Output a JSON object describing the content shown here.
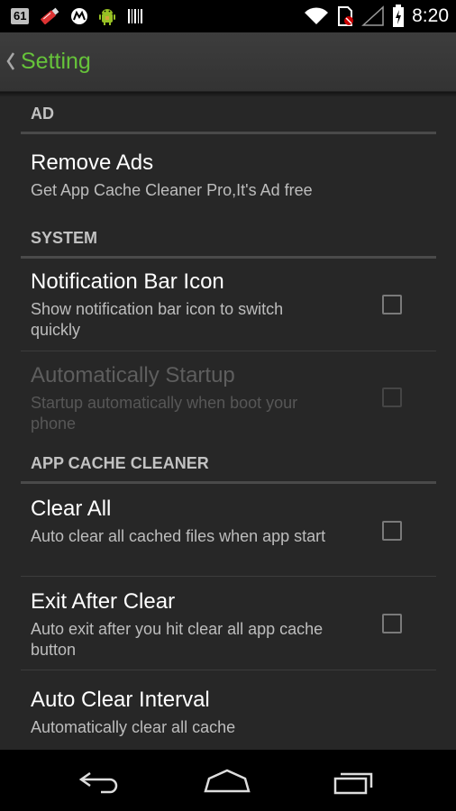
{
  "status_bar": {
    "badge": "61",
    "time": "8:20",
    "icons": [
      "usb-icon",
      "motorola-icon",
      "android-debug-icon",
      "barcode-icon",
      "wifi-icon",
      "no-sim-icon",
      "signal-icon",
      "battery-charging-icon"
    ]
  },
  "action_bar": {
    "title": "Setting",
    "title_color": "#66c33a"
  },
  "sections": {
    "ad": {
      "header": "AD",
      "remove_ads": {
        "title": "Remove Ads",
        "summary": "Get App Cache Cleaner Pro,It's Ad free"
      }
    },
    "system": {
      "header": "SYSTEM",
      "notification_icon": {
        "title": "Notification Bar Icon",
        "summary": "Show notification bar icon to switch quickly",
        "checked": false
      },
      "auto_startup": {
        "title": "Automatically Startup",
        "summary": "Startup automatically when boot your phone",
        "checked": false,
        "enabled": false
      }
    },
    "cleaner": {
      "header": "APP CACHE CLEANER",
      "clear_all": {
        "title": "Clear All",
        "summary": "Auto clear all cached files when app start",
        "checked": false
      },
      "exit_after_clear": {
        "title": "Exit After Clear",
        "summary": "Auto exit after you hit clear all app cache button",
        "checked": false
      },
      "auto_clear_interval": {
        "title": "Auto Clear Interval",
        "summary": "Automatically clear all cache"
      }
    }
  },
  "nav_bar": {
    "icons": [
      "back-icon",
      "home-icon",
      "recents-icon"
    ]
  }
}
